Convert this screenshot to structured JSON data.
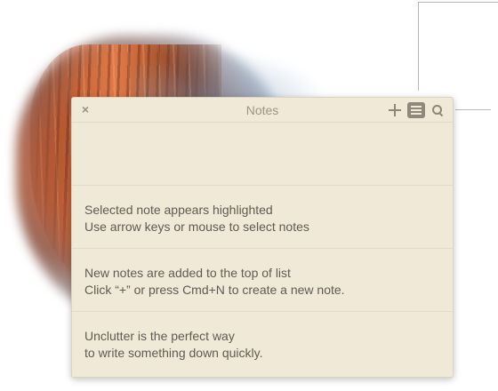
{
  "window": {
    "title": "Notes",
    "close_glyph": "×",
    "toolbar": {
      "add_icon": "plus-icon",
      "list_icon": "list-icon",
      "search_icon": "search-icon"
    }
  },
  "notes": [
    {
      "line1": "",
      "line2": ""
    },
    {
      "line1": "Selected note appears highlighted",
      "line2": "Use arrow keys or mouse to select notes"
    },
    {
      "line1": "New notes are added to the top of list",
      "line2": "Click “+” or press Cmd+N to create a new note."
    },
    {
      "line1": "Unclutter is the perfect way",
      "line2": "to write something down quickly."
    }
  ],
  "colors": {
    "panel_background": "#f1e9d8",
    "text": "#5f5a52",
    "title_text": "#9b9385",
    "icon": "#8e877a"
  }
}
